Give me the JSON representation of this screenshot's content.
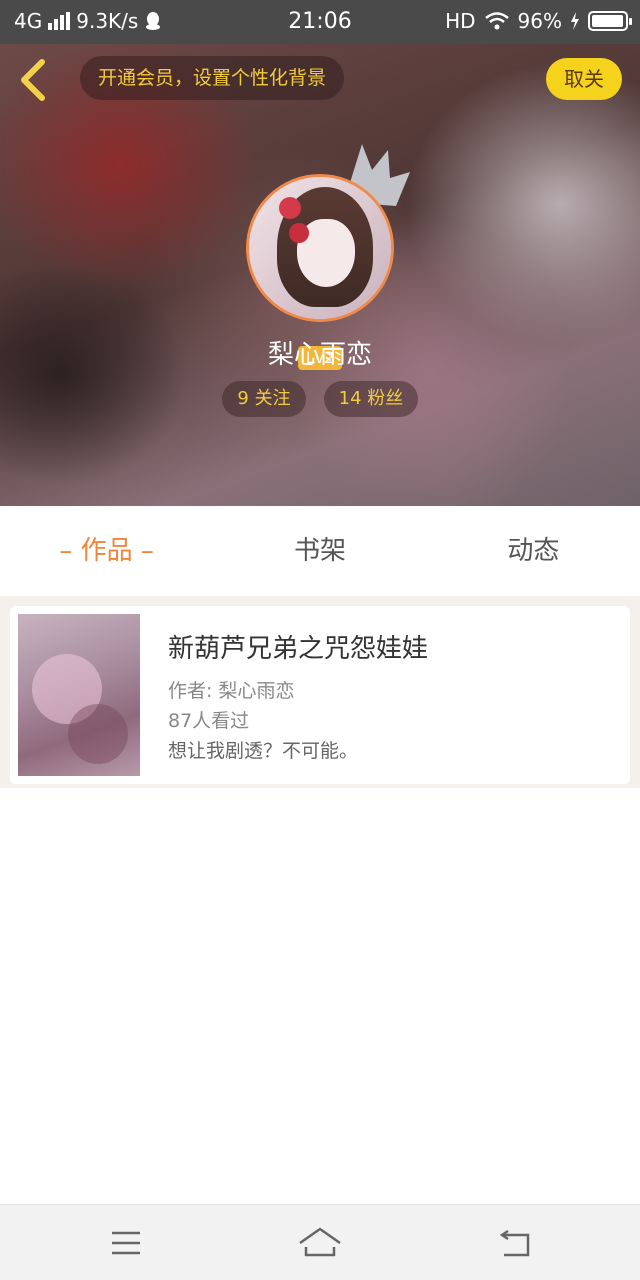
{
  "status_bar": {
    "network": "4G",
    "speed": "9.3K/s",
    "time": "21:06",
    "hd": "HD",
    "battery": "96%",
    "battery_level": 0.96
  },
  "header": {
    "vip_text": "开通会员，设置个性化背景",
    "follow_button": "取关",
    "level": "Lv2",
    "username": "梨心雨恋",
    "following": "9 关注",
    "fans": "14 粉丝"
  },
  "tabs": [
    {
      "label": "– 作品 –",
      "active": true
    },
    {
      "label": "书架",
      "active": false
    },
    {
      "label": "动态",
      "active": false
    }
  ],
  "works": [
    {
      "title": "新葫芦兄弟之咒怨娃娃",
      "author": "作者: 梨心雨恋",
      "views": "87人看过",
      "description": "想让我剧透？不可能。"
    }
  ],
  "colors": {
    "accent": "#f0843a",
    "gold": "#f2cc3c",
    "follow_bg": "#f5d31c"
  },
  "icons": {
    "back": "chevron-left-icon",
    "crown": "crown-icon",
    "menu": "menu-icon",
    "home": "home-icon",
    "return": "return-icon"
  }
}
